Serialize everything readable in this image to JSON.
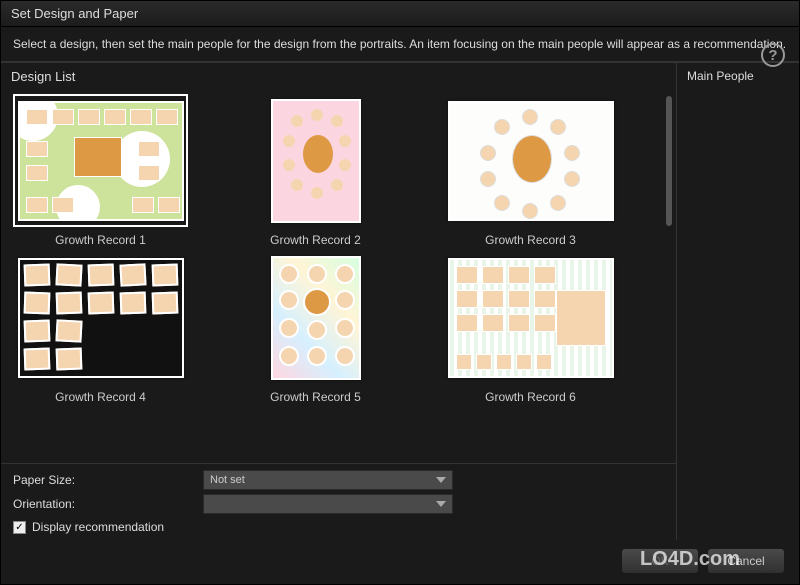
{
  "window": {
    "title": "Set Design and Paper"
  },
  "instruction": "Select a design, then set the main people for the design from the portraits. An item focusing on the main people will appear as a recommendation.",
  "headers": {
    "design_list": "Design List",
    "main_people": "Main People"
  },
  "designs": [
    {
      "label": "Growth Record 1",
      "orientation": "landscape",
      "selected": true
    },
    {
      "label": "Growth Record 2",
      "orientation": "portrait",
      "selected": false
    },
    {
      "label": "Growth Record 3",
      "orientation": "landscape",
      "selected": false
    },
    {
      "label": "Growth Record 4",
      "orientation": "landscape",
      "selected": false
    },
    {
      "label": "Growth Record 5",
      "orientation": "portrait",
      "selected": false
    },
    {
      "label": "Growth Record 6",
      "orientation": "landscape",
      "selected": false
    }
  ],
  "controls": {
    "paper_size_label": "Paper Size:",
    "paper_size_value": "Not set",
    "orientation_label": "Orientation:",
    "orientation_value": "",
    "display_recommendation_label": "Display recommendation",
    "display_recommendation_checked": true
  },
  "buttons": {
    "ok": "OK",
    "cancel": "Cancel"
  },
  "watermark": "LO4D.com"
}
